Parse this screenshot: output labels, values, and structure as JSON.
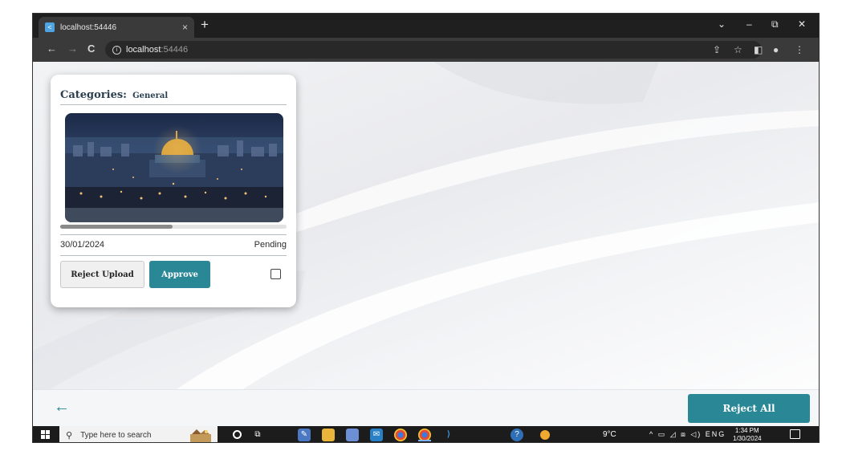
{
  "browser": {
    "tab_title": "localhost:54446",
    "tab_favicon": "<",
    "close_tab_icon": "×",
    "new_tab_icon": "+",
    "url_host": "localhost",
    "url_port": ":54446",
    "nav": {
      "back": "←",
      "forward": "→",
      "reload": "C"
    },
    "window_controls": {
      "dropdown": "⌄",
      "minimize": "–",
      "restore": "⧉",
      "close": "✕"
    },
    "toolbar_icons": {
      "share": "⇪",
      "star": "☆",
      "sidebar": "◧",
      "profile": "●",
      "menu": "⋮"
    }
  },
  "card": {
    "category_label": "Categories:",
    "category_value": "General",
    "photo_icon": "photo-jerusalem-dome-of-the-rock",
    "date": "30/01/2024",
    "status": "Pending",
    "reject_upload_label": "Reject Upload",
    "approve_label": "Approve",
    "selected": false
  },
  "footer": {
    "back_arrow": "←",
    "reject_all_label": "Reject All"
  },
  "taskbar": {
    "search_placeholder": "Type here to search",
    "search_icon": "⚲",
    "weather": "9°C",
    "tray": "^ ▭ ◿ ⧈ ◁) ENG",
    "time": "1:34 PM",
    "date": "1/30/2024"
  },
  "colors": {
    "accent": "#2a8796",
    "chrome_dark": "#1f1f1f",
    "taskbar": "#1c1c1c"
  }
}
